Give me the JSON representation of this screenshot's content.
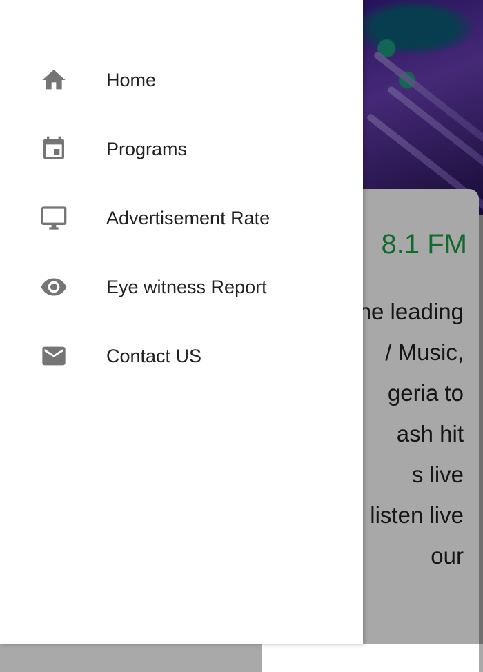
{
  "background": {
    "station_title": "8.1 FM",
    "text_lines": [
      "ne leading",
      "/ Music,",
      "geria to",
      "ash hit",
      "s live",
      "listen live",
      "our"
    ]
  },
  "drawer": {
    "items": [
      {
        "label": "Home",
        "icon": "home-icon"
      },
      {
        "label": "Programs",
        "icon": "calendar-icon"
      },
      {
        "label": "Advertisement Rate",
        "icon": "monitor-icon"
      },
      {
        "label": "Eye witness Report",
        "icon": "eye-icon"
      },
      {
        "label": "Contact US",
        "icon": "mail-icon"
      }
    ]
  },
  "colors": {
    "accent_green": "#19a247",
    "icon_grey": "#757575"
  }
}
